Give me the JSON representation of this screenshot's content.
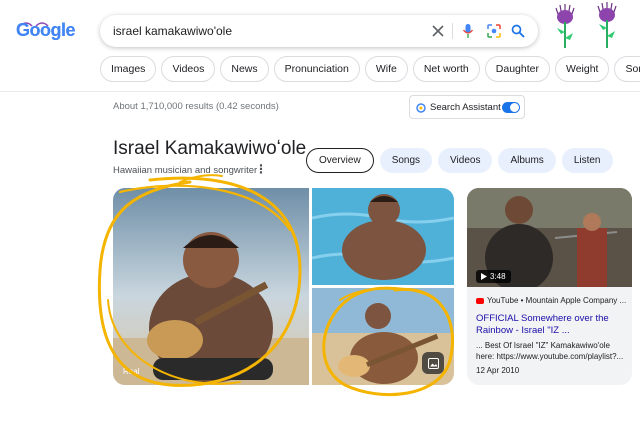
{
  "logo": {
    "text": "Google"
  },
  "search": {
    "query": "israel kamakawiwo'ole",
    "icons": [
      "clear-icon",
      "microphone-icon",
      "lens-icon",
      "search-icon"
    ]
  },
  "chips": [
    "Images",
    "Videos",
    "News",
    "Pronunciation",
    "Wife",
    "Net worth",
    "Daughter",
    "Weight",
    "Song"
  ],
  "results": {
    "count_text": "About 1,710,000 results (0.42 seconds)"
  },
  "assistant": {
    "label": "Search Assistant",
    "enabled": true
  },
  "knowledge_panel": {
    "title": "Israel Kamakawiwoʻole",
    "subtitle": "Hawaiian musician and songwriter",
    "more": "⋮",
    "tabs": [
      {
        "label": "Overview",
        "active": true
      },
      {
        "label": "Songs",
        "active": false
      },
      {
        "label": "Videos",
        "active": false
      },
      {
        "label": "Albums",
        "active": false
      },
      {
        "label": "Listen",
        "active": false
      }
    ]
  },
  "gallery": {
    "caption": "Real"
  },
  "video": {
    "duration": "3:48",
    "source": "YouTube • Mountain Apple Company ...",
    "title": "OFFICIAL Somewhere over the Rainbow - Israel \"IZ ...",
    "description": "... Best Of Israel \"IZ\" Kamakawiwo'ole here: https://www.youtube.com/playlist?...",
    "date": "12 Apr 2010"
  },
  "colors": {
    "accent_blue": "#1a73e8",
    "chip_bg": "#e8f0fe",
    "link": "#1a0dab",
    "highlight": "#f4b400"
  }
}
